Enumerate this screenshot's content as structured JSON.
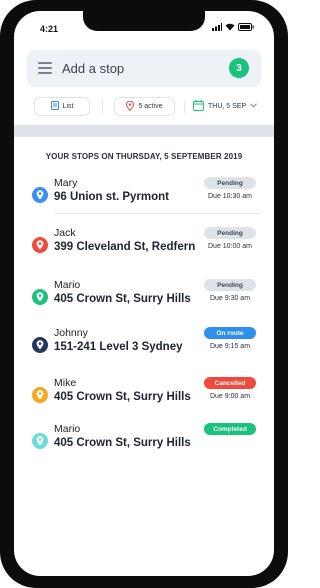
{
  "status_bar": {
    "time": "4:21"
  },
  "search": {
    "placeholder": "Add a stop",
    "count": "3"
  },
  "filters": {
    "list_label": "List",
    "active_label": "5 active",
    "date_label": "THU, 5 SEP"
  },
  "section": {
    "title": "YOUR STOPS ON THURSDAY, 5 SEPTEMBER 2019"
  },
  "colors": {
    "accent": "#19c37d",
    "pending_bg": "#dfe3e8",
    "on_route_bg": "#2f8ff0",
    "cancelled_bg": "#f0493d",
    "completed_bg": "#19c37d"
  },
  "stops": [
    {
      "name": "Mary",
      "address": "96 Union st. Pyrmont",
      "status": "Pending",
      "due": "Due 10:30 am",
      "pin_color": "#3d8ff0",
      "status_bg": "#dfe3e8",
      "status_fg": "#3c4350"
    },
    {
      "name": "Jack",
      "address": "399 Cleveland St, Redfern",
      "status": "Pending",
      "due": "Due 10:00 am",
      "pin_color": "#f0493d",
      "status_bg": "#dfe3e8",
      "status_fg": "#3c4350"
    },
    {
      "name": "Mario",
      "address": "405 Crown St, Surry Hills",
      "status": "Pending",
      "due": "Due 9:30 am",
      "pin_color": "#19c37d",
      "status_bg": "#dfe3e8",
      "status_fg": "#3c4350"
    },
    {
      "name": "Johnny",
      "address": "151-241 Level 3 Sydney",
      "status": "On route",
      "due": "Due 9:15 am",
      "pin_color": "#24375a",
      "status_bg": "#2f8ff0",
      "status_fg": "#ffffff"
    },
    {
      "name": "Mike",
      "address": "405 Crown St, Surry Hills",
      "status": "Cancelled",
      "due": "Due 9:00 am",
      "pin_color": "#f5a623",
      "status_bg": "#f0493d",
      "status_fg": "#ffffff"
    },
    {
      "name": "Mario",
      "address": "405 Crown St, Surry Hills",
      "status": "Completed",
      "due": "",
      "pin_color": "#6fdbd8",
      "status_bg": "#19c37d",
      "status_fg": "#ffffff"
    }
  ]
}
